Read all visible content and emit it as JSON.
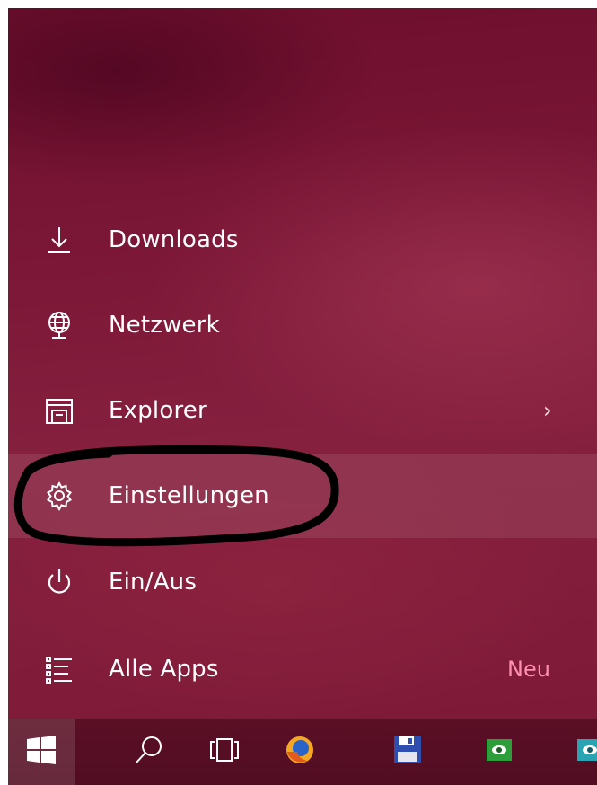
{
  "start_menu": {
    "items": [
      {
        "label": "Downloads",
        "icon": "download-icon"
      },
      {
        "label": "Netzwerk",
        "icon": "network-icon"
      },
      {
        "label": "Explorer",
        "icon": "file-explorer-icon",
        "chevron": "›"
      },
      {
        "label": "Einstellungen",
        "icon": "settings-gear-icon"
      },
      {
        "label": "Ein/Aus",
        "icon": "power-icon"
      },
      {
        "label": "Alle Apps",
        "icon": "all-apps-list-icon",
        "badge": "Neu"
      }
    ]
  },
  "taskbar": {
    "buttons": [
      {
        "icon": "windows-start-icon"
      },
      {
        "icon": "search-icon"
      },
      {
        "icon": "task-view-icon"
      },
      {
        "icon": "firefox-icon"
      },
      {
        "icon": "floppy-save-icon"
      },
      {
        "icon": "green-app-icon"
      },
      {
        "icon": "teal-app-icon"
      }
    ]
  },
  "colors": {
    "menu_background": "#7c1737",
    "taskbar_background": "#560e23",
    "badge_new": "#ff8fb0",
    "annotation_stroke": "#000000"
  }
}
